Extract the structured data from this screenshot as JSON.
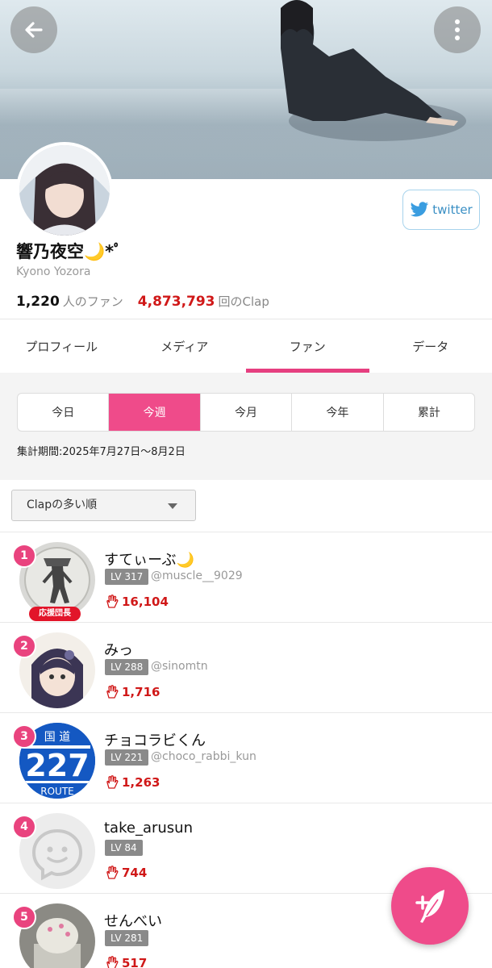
{
  "header": {
    "back_icon": "arrow-left-icon",
    "more_icon": "more-vertical-icon"
  },
  "profile": {
    "name": "響乃夜空🌙*ﾟ",
    "romaji": "Kyono Yozora",
    "fans_count": "1,220",
    "fans_label": "人のファン",
    "clap_count": "4,873,793",
    "clap_label": "回のClap",
    "twitter_label": "twitter"
  },
  "tabs": [
    {
      "label": "プロフィール",
      "active": false
    },
    {
      "label": "メディア",
      "active": false
    },
    {
      "label": "ファン",
      "active": true
    },
    {
      "label": "データ",
      "active": false
    }
  ],
  "periods": [
    {
      "label": "今日",
      "active": false
    },
    {
      "label": "今週",
      "active": true
    },
    {
      "label": "今月",
      "active": false
    },
    {
      "label": "今年",
      "active": false
    },
    {
      "label": "累計",
      "active": false
    }
  ],
  "period_text": "集計期間:2025年7月27日〜8月2日",
  "sort": {
    "selected": "Clapの多い順"
  },
  "fans": [
    {
      "rank": "1",
      "name": "すてぃーぶ🌙",
      "level": "LV 317",
      "handle": "@muscle__9029",
      "claps": "16,104",
      "badge": "応援団長"
    },
    {
      "rank": "2",
      "name": "みっ",
      "level": "LV 288",
      "handle": "@sinomtn",
      "claps": "1,716"
    },
    {
      "rank": "3",
      "name": "チョコラビくん",
      "level": "LV 221",
      "handle": "@choco_rabbi_kun",
      "claps": "1,263",
      "avatar_text": {
        "top": "国 道",
        "num": "227",
        "bottom": "ROUTE"
      }
    },
    {
      "rank": "4",
      "name": "take_arusun",
      "level": "LV 84",
      "handle": "",
      "claps": "744"
    },
    {
      "rank": "5",
      "name": "せんべい",
      "level": "LV 281",
      "handle": "",
      "claps": "517"
    }
  ],
  "colors": {
    "accent": "#ef4b8a",
    "clap": "#d01818",
    "twitter": "#3a8fc4"
  }
}
